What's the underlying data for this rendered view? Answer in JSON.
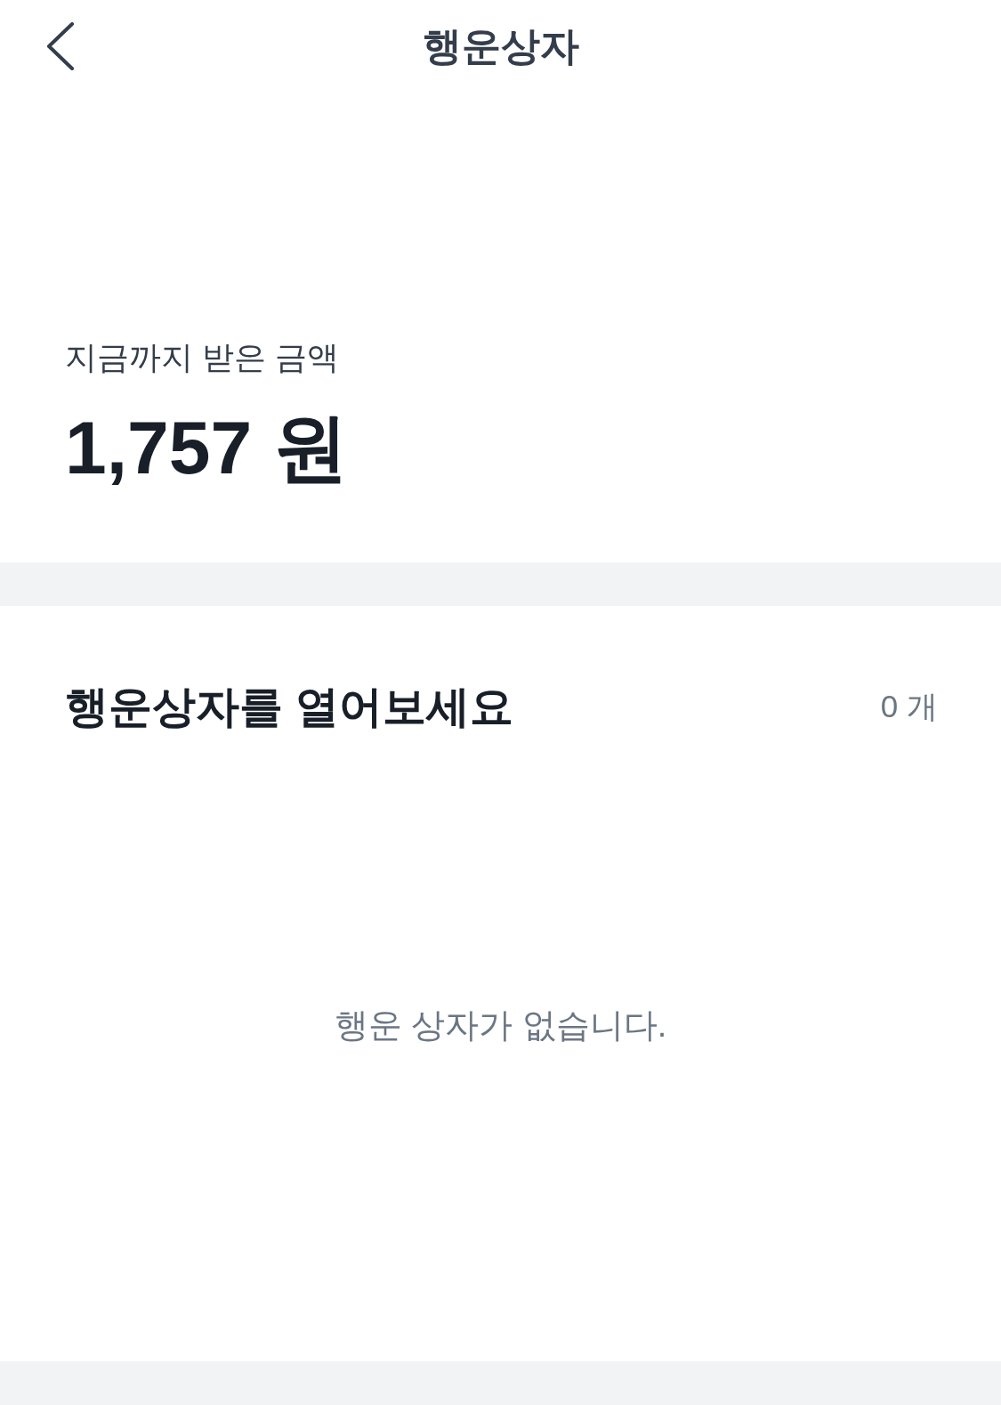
{
  "header": {
    "title": "행운상자"
  },
  "summary": {
    "label": "지금까지 받은 금액",
    "amount": "1,757 원"
  },
  "boxes": {
    "heading": "행운상자를 열어보세요",
    "count": "0 개",
    "empty_message": "행운 상자가 없습니다."
  }
}
